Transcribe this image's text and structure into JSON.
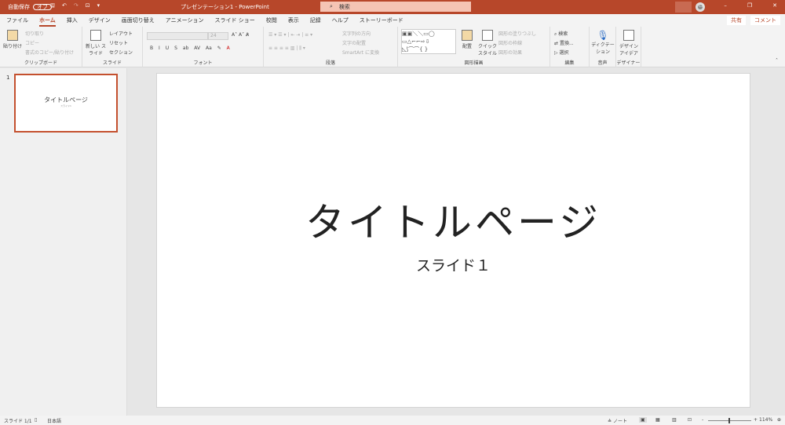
{
  "titlebar": {
    "autosave": "自動保存",
    "toggle": "オフ",
    "doc_title": "プレゼンテーション1  -  PowerPoint",
    "search_placeholder": "検索"
  },
  "tabs": [
    "ファイル",
    "ホーム",
    "挿入",
    "デザイン",
    "画面切り替え",
    "アニメーション",
    "スライド ショー",
    "校閲",
    "表示",
    "記録",
    "ヘルプ",
    "ストーリーボード"
  ],
  "share": "共有",
  "comment": "コメント",
  "ribbon": {
    "clipboard": {
      "paste": "貼り付け",
      "cut": "切り取り",
      "copy": "コピー",
      "format_painter": "書式のコピー/貼り付け",
      "label": "クリップボード"
    },
    "slides": {
      "new_slide": "新しい スライド",
      "layout": "レイアウト",
      "reset": "リセット",
      "section": "セクション",
      "label": "スライド"
    },
    "font": {
      "size": "24",
      "label": "フォント",
      "buttons": [
        "B",
        "I",
        "U",
        "S",
        "ab",
        "AV",
        "Aa"
      ]
    },
    "paragraph": {
      "text_direction": "文字列の方向",
      "align_text": "文字の配置",
      "smartart": "SmartArt に変換",
      "label": "段落"
    },
    "drawing": {
      "arrange": "配置",
      "quick_styles": "クイック スタイル",
      "fill": "図形の塗りつぶし",
      "outline": "図形の枠線",
      "effects": "図形の効果",
      "label": "図形描画"
    },
    "editing": {
      "find": "検索",
      "replace": "置換...",
      "select": "選択",
      "label": "編集"
    },
    "voice": {
      "dictate": "ディクテーション",
      "label": "音声"
    },
    "designer": {
      "ideas": "デザイン アイデア",
      "label": "デザイナー"
    }
  },
  "thumb": {
    "number": "1",
    "title": "タイトルページ",
    "subtitle": "スライド1"
  },
  "slide": {
    "title": "タイトルページ",
    "subtitle": "スライド１"
  },
  "status": {
    "slide": "スライド 1/1",
    "language": "日本語",
    "notes": "ノート",
    "zoom": "114%"
  }
}
